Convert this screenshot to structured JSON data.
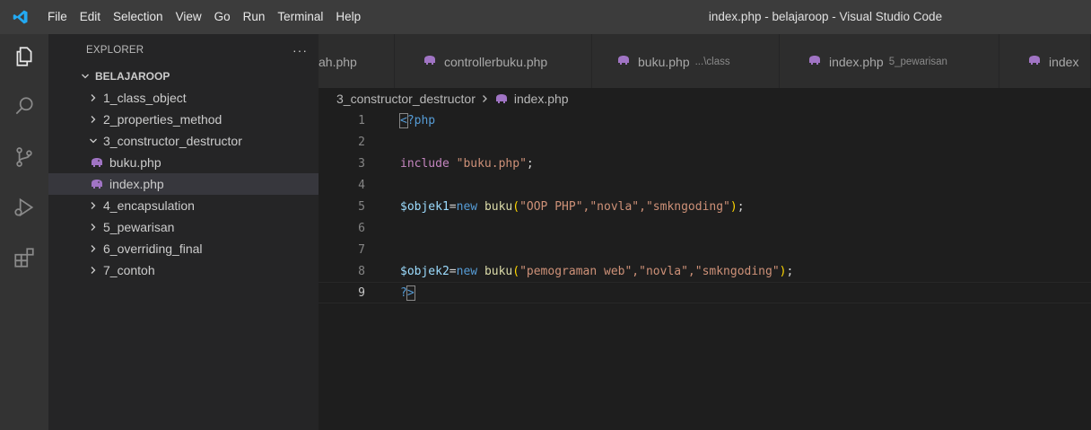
{
  "window": {
    "title": "index.php - belajaroop - Visual Studio Code"
  },
  "menu": [
    "File",
    "Edit",
    "Selection",
    "View",
    "Go",
    "Run",
    "Terminal",
    "Help"
  ],
  "explorer": {
    "title": "EXPLORER",
    "more": "···",
    "root": "BELAJAROOP",
    "items": [
      {
        "label": "1_class_object",
        "type": "folder"
      },
      {
        "label": "2_properties_method",
        "type": "folder"
      },
      {
        "label": "3_constructor_destructor",
        "type": "folder-open"
      },
      {
        "label": "buku.php",
        "type": "file"
      },
      {
        "label": "index.php",
        "type": "file",
        "selected": true
      },
      {
        "label": "4_encapsulation",
        "type": "folder"
      },
      {
        "label": "5_pewarisan",
        "type": "folder"
      },
      {
        "label": "6_overriding_final",
        "type": "folder"
      },
      {
        "label": "7_contoh",
        "type": "folder"
      }
    ]
  },
  "tabs": [
    {
      "label": "ah.php",
      "desc": "",
      "icon": ""
    },
    {
      "label": "controllerbuku.php",
      "desc": "",
      "icon": "php-elephant-icon"
    },
    {
      "label": "buku.php",
      "desc": "...\\class",
      "icon": "php-elephant-icon"
    },
    {
      "label": "index.php",
      "desc": "5_pewarisan",
      "icon": "php-elephant-icon"
    },
    {
      "label": "index",
      "desc": "",
      "icon": "php-elephant-icon"
    }
  ],
  "breadcrumb": {
    "folder": "3_constructor_destructor",
    "file": "index.php"
  },
  "editor": {
    "line_numbers": [
      "1",
      "2",
      "3",
      "4",
      "5",
      "6",
      "7",
      "8",
      "9"
    ],
    "current_line": "9",
    "code": {
      "l1_open": "<",
      "l1_rest": "?php",
      "l3_kw": "include",
      "l3_str": "\"buku.php\"",
      "l3_end": ";",
      "l5_var": "$objek1",
      "l5_eq": "=",
      "l5_new": "new",
      "l5_fn": "buku",
      "l5_args": "\"OOP PHP\",\"novla\",\"smkngoding\"",
      "l8_var": "$objek2",
      "l8_eq": "=",
      "l8_new": "new",
      "l8_fn": "buku",
      "l8_args": "\"pemograman web\",\"novla\",\"smkngoding\"",
      "lparen": "(",
      "rparen": ")",
      "semi": ";",
      "comma": ",",
      "l9_q": "?",
      "l9_gt": ">"
    }
  },
  "colors": {
    "accent": "#007acc",
    "php_icon": "#a074c4",
    "vsc_logo": "#0098ff"
  }
}
